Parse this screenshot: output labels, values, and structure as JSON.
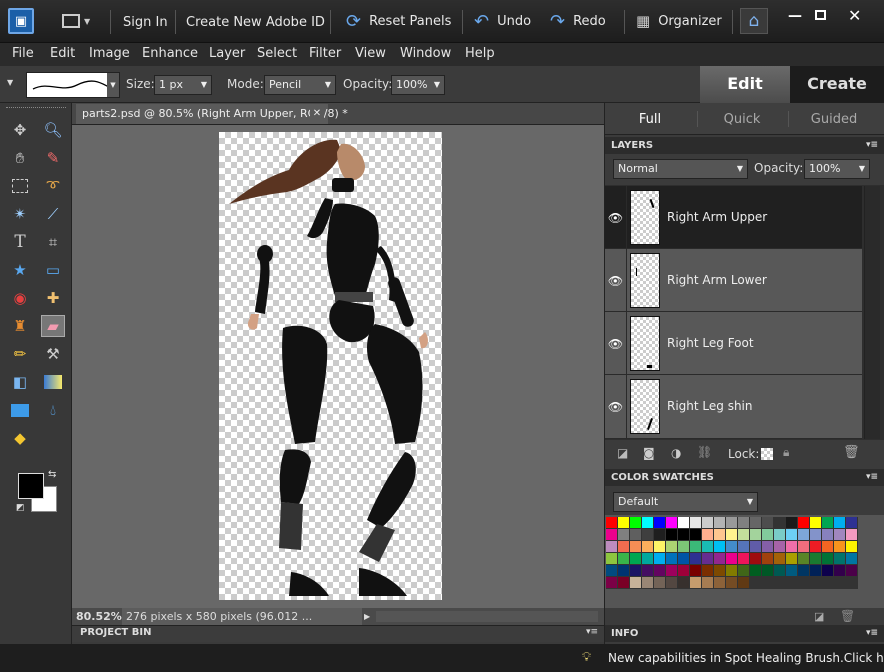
{
  "title_bar": {
    "sign_in": "Sign In",
    "create_id": "Create New Adobe ID",
    "reset_panels": "Reset Panels",
    "undo": "Undo",
    "redo": "Redo",
    "organizer": "Organizer"
  },
  "menu": [
    "File",
    "Edit",
    "Image",
    "Enhance",
    "Layer",
    "Select",
    "Filter",
    "View",
    "Window",
    "Help"
  ],
  "options": {
    "size_label": "Size:",
    "size_value": "1 px",
    "mode_label": "Mode:",
    "mode_value": "Pencil",
    "opacity_label": "Opacity:",
    "opacity_value": "100%"
  },
  "tabs": {
    "edit": "Edit",
    "create": "Create"
  },
  "modes": {
    "full": "Full",
    "quick": "Quick",
    "guided": "Guided"
  },
  "document": {
    "tab_title": "parts2.psd @ 80.5% (Right Arm Upper, RGB/8) *",
    "zoom": "80.52%",
    "info": "276 pixels x 580 pixels (96.012 ..."
  },
  "project_bin": "PROJECT BIN",
  "layers_panel": {
    "header": "LAYERS",
    "blend_mode": "Normal",
    "opacity_label": "Opacity:",
    "opacity_value": "100%",
    "lock_label": "Lock:",
    "layers": [
      {
        "name": "Right Arm Upper"
      },
      {
        "name": "Right Arm Lower"
      },
      {
        "name": "Right Leg Foot"
      },
      {
        "name": "Right Leg shin"
      }
    ]
  },
  "swatches_panel": {
    "header": "COLOR SWATCHES",
    "preset": "Default",
    "colors": [
      "#ff0000",
      "#ffff00",
      "#00ff00",
      "#00ffff",
      "#0000ff",
      "#ff00ff",
      "#ffffff",
      "#e6e6e6",
      "#cccccc",
      "#b3b3b3",
      "#999999",
      "#808080",
      "#666666",
      "#4d4d4d",
      "#333333",
      "#1a1a1a",
      "#ff0000",
      "#ffff00",
      "#00a651",
      "#00aeef",
      "#2e3192",
      "#ec008c",
      "#7f7f7f",
      "#5f5f5f",
      "#3f3f3f",
      "#1f1f1f",
      "#000000",
      "#000000",
      "#000000",
      "#ffaf8f",
      "#ffc68f",
      "#fff38f",
      "#c4df9b",
      "#a3d39c",
      "#82ca9c",
      "#7accc8",
      "#6dcff6",
      "#7da7d9",
      "#8393ca",
      "#8781bd",
      "#a186be",
      "#f49ac1",
      "#bd8cbf",
      "#f26c4f",
      "#f68e55",
      "#fbaf5c",
      "#fff467",
      "#acd372",
      "#7cc576",
      "#3bb878",
      "#1abbb4",
      "#00bff3",
      "#438ccb",
      "#5574b9",
      "#605ca8",
      "#855fa8",
      "#a763a8",
      "#f06ea9",
      "#f26d7d",
      "#ed1c24",
      "#f26522",
      "#f7941d",
      "#fff200",
      "#8dc63f",
      "#39b54a",
      "#00a651",
      "#00a99d",
      "#00aeef",
      "#0072bc",
      "#0054a6",
      "#2e3192",
      "#662d91",
      "#92278f",
      "#ec008c",
      "#ed145b",
      "#9e0b0f",
      "#a0410d",
      "#a36209",
      "#aba000",
      "#598527",
      "#1a7b30",
      "#007236",
      "#00746b",
      "#0076a3",
      "#004b80",
      "#003471",
      "#1b1464",
      "#440e62",
      "#630460",
      "#9e005d",
      "#9e0039",
      "#790000",
      "#7b2e00",
      "#7d4900",
      "#827b00",
      "#406618",
      "#005e20",
      "#005826",
      "#005952",
      "#005b7f",
      "#003663",
      "#002157",
      "#0d004c",
      "#32004b",
      "#4b0049",
      "#7b0046",
      "#7a0026",
      "#c7b299",
      "#998675",
      "#736357",
      "#534741",
      "#37302d",
      "#c69c6d",
      "#a67c52",
      "#8c6239",
      "#754c24",
      "#603913",
      "#333333",
      "#333333",
      "#333333",
      "#333333",
      "#333333",
      "#333333",
      "#333333",
      "#333333",
      "#333333"
    ]
  },
  "info_panel": {
    "header": "INFO"
  },
  "bottom_message": "New capabilities in Spot Healing Brush.Click here"
}
